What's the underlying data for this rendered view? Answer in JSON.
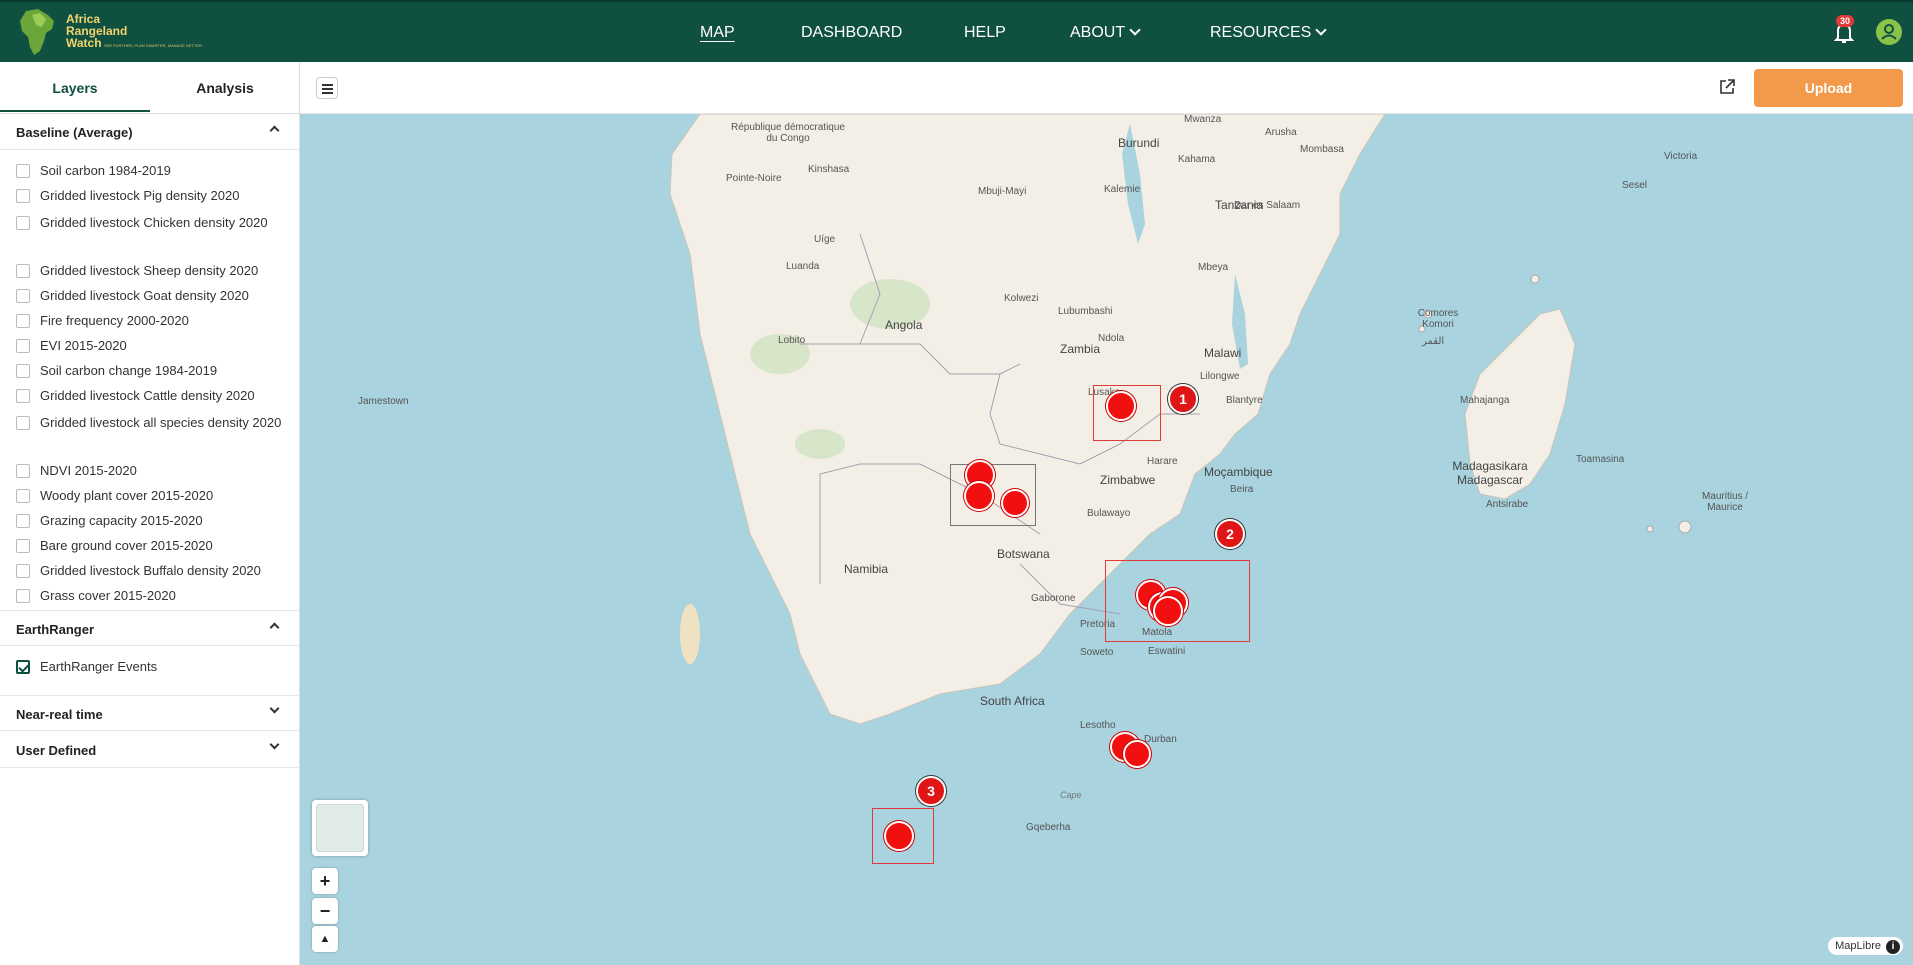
{
  "header": {
    "logo_text": "Africa Rangeland Watch",
    "logo_tagline": "SEE FURTHER, PLAN SMARTER, MANAGE BETTER",
    "nav": {
      "map": "MAP",
      "dashboard": "DASHBOARD",
      "help": "HELP",
      "about": "ABOUT",
      "resources": "RESOURCES"
    },
    "notification_count": "30"
  },
  "sidebar": {
    "tabs": {
      "layers": "Layers",
      "analysis": "Analysis"
    },
    "baseline": {
      "title": "Baseline (Average)",
      "items": [
        {
          "label": "Soil carbon 1984-2019",
          "checked": false
        },
        {
          "label": "Gridded livestock Pig density 2020",
          "checked": false
        },
        {
          "label": "Gridded livestock Chicken density 2020",
          "checked": false
        },
        {
          "label": "Gridded livestock Sheep density 2020",
          "checked": false
        },
        {
          "label": "Gridded livestock Goat density 2020",
          "checked": false
        },
        {
          "label": "Fire frequency 2000-2020",
          "checked": false
        },
        {
          "label": "EVI 2015-2020",
          "checked": false
        },
        {
          "label": "Soil carbon change 1984-2019",
          "checked": false
        },
        {
          "label": "Gridded livestock Cattle density 2020",
          "checked": false
        },
        {
          "label": "Gridded livestock all species density 2020",
          "checked": false
        },
        {
          "label": "NDVI 2015-2020",
          "checked": false
        },
        {
          "label": "Woody plant cover 2015-2020",
          "checked": false
        },
        {
          "label": "Grazing capacity 2015-2020",
          "checked": false
        },
        {
          "label": "Bare ground cover 2015-2020",
          "checked": false
        },
        {
          "label": "Gridded livestock Buffalo density 2020",
          "checked": false
        },
        {
          "label": "Grass cover 2015-2020",
          "checked": false
        }
      ]
    },
    "earthranger": {
      "title": "EarthRanger",
      "items": [
        {
          "label": "EarthRanger Events",
          "checked": true
        }
      ]
    },
    "near_real_time": {
      "title": "Near-real time"
    },
    "user_defined": {
      "title": "User Defined"
    }
  },
  "toolbar": {
    "upload_label": "Upload"
  },
  "map": {
    "clusters": [
      {
        "label": "1"
      },
      {
        "label": "2"
      },
      {
        "label": "3"
      }
    ],
    "labels": {
      "republique": "République démocratique du Congo",
      "burundi": "Burundi",
      "tanzania": "Tanzania",
      "angola": "Angola",
      "zambia": "Zambia",
      "malawi": "Malawi",
      "mocambique": "Moçambique",
      "zimbabwe": "Zimbabwe",
      "botswana": "Botswana",
      "namibia": "Namibia",
      "south_africa": "South Africa",
      "lesotho": "Lesotho",
      "eswatini": "Eswatini",
      "madagasikara": "Madagasikara Madagascar",
      "comores": "Comores Komori",
      "comores_ar": "القمر",
      "jamestown": "Jamestown",
      "pointe_noire": "Pointe-Noire",
      "kinshasa": "Kinshasa",
      "luanda": "Luanda",
      "lobito": "Lobito",
      "lusaka": "Lusaka",
      "harare": "Harare",
      "lilongwe": "Lilongwe",
      "blantyre": "Blantyre",
      "beira": "Beira",
      "bulawayo": "Bulawayo",
      "gaborone": "Gaborone",
      "pretoria": "Pretoria",
      "soweto": "Soweto",
      "matola": "Matola",
      "durban": "Durban",
      "gqeberha": "Gqeberha",
      "dar_es_salaam": "Dar es Salaam",
      "mombasa": "Mombasa",
      "mwanza": "Mwanza",
      "arusha": "Arusha",
      "kahama": "Kahama",
      "kalemie": "Kalemie",
      "mbeya": "Mbeya",
      "kolwezi": "Kolwezi",
      "lubumbashi": "Lubumbashi",
      "ndola": "Ndola",
      "mahajanga": "Mahajanga",
      "toamasina": "Toamasina",
      "antsirabe": "Antsirabe",
      "victoria": "Victoria",
      "sesel": "Sesel",
      "mauritius": "Mauritius / Maurice",
      "uige": "Uíge",
      "mbuji_mayi": "Mbuji-Mayi",
      "cape": "Cape"
    },
    "attribution": "MapLibre"
  }
}
